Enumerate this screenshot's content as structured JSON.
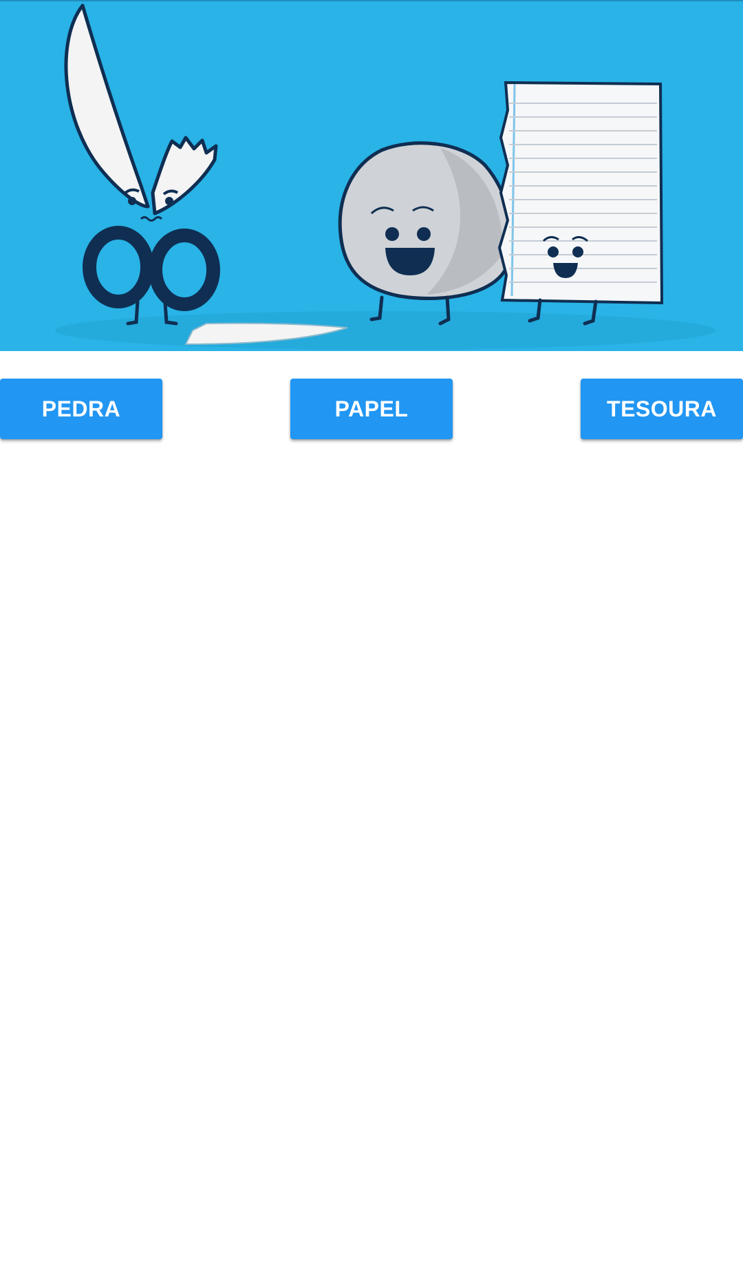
{
  "app": {
    "background": "#ffffff",
    "accent": "#2196f3"
  },
  "banner": {
    "image": "rock-paper-scissors-illustration",
    "background_color": "#29b3e6",
    "characters": [
      "scissors-character",
      "rock-character",
      "paper-character"
    ]
  },
  "buttons": {
    "pedra": "PEDRA",
    "papel": "PAPEL",
    "tesoura": "TESOURA"
  }
}
